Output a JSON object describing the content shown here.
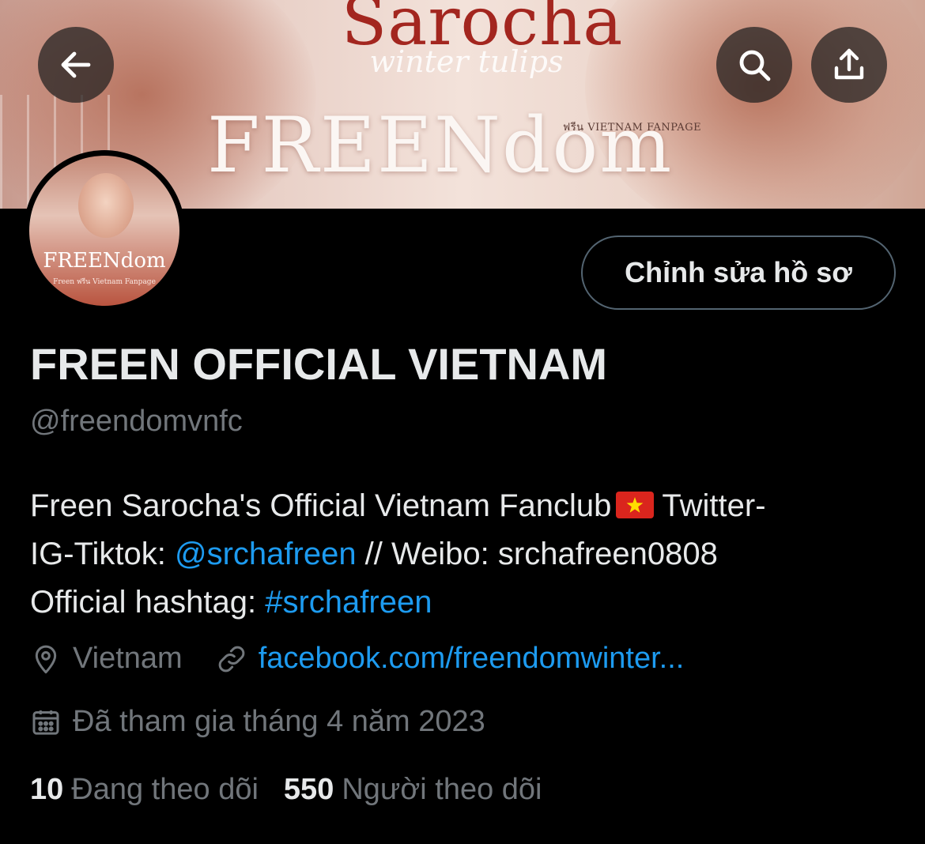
{
  "banner": {
    "title_script": "Sarocha",
    "subtitle_script": "winter tulips",
    "fanpage_tag": "ฟรีน VIETNAM FANPAGE",
    "brand_word": "FREENdom"
  },
  "header": {
    "back_icon": "back-arrow-icon",
    "search_icon": "search-icon",
    "share_icon": "share-icon"
  },
  "avatar": {
    "brand_word": "FREENdom",
    "tiny_text": "Freen ฟรีน Vietnam Fanpage"
  },
  "profile": {
    "edit_button_label": "Chỉnh sửa hồ sơ",
    "display_name": "FREEN OFFICIAL VIETNAM",
    "handle": "@freendomvnfc",
    "bio": {
      "line1_text": "Freen Sarocha's Official Vietnam Fanclub",
      "line1_flag_icon": "vietnam-flag-icon",
      "line1_tail": "Twitter-",
      "line2_prefix": "IG-Tiktok: ",
      "line2_mention": "@srchafreen",
      "line2_suffix": " // Weibo: srchafreen0808",
      "line3_prefix": "Official hashtag: ",
      "line3_hashtag": "#srchafreen"
    },
    "location": "Vietnam",
    "website": "facebook.com/freendomwinter...",
    "joined": "Đã tham gia tháng 4 năm 2023"
  },
  "stats": {
    "following_count": "10",
    "following_label": "Đang theo dõi",
    "followers_count": "550",
    "followers_label": "Người theo dõi"
  },
  "colors": {
    "background": "#000000",
    "text_primary": "#e7e9ea",
    "text_secondary": "#71767b",
    "link_blue": "#1d9bf0",
    "button_border": "#536471"
  }
}
